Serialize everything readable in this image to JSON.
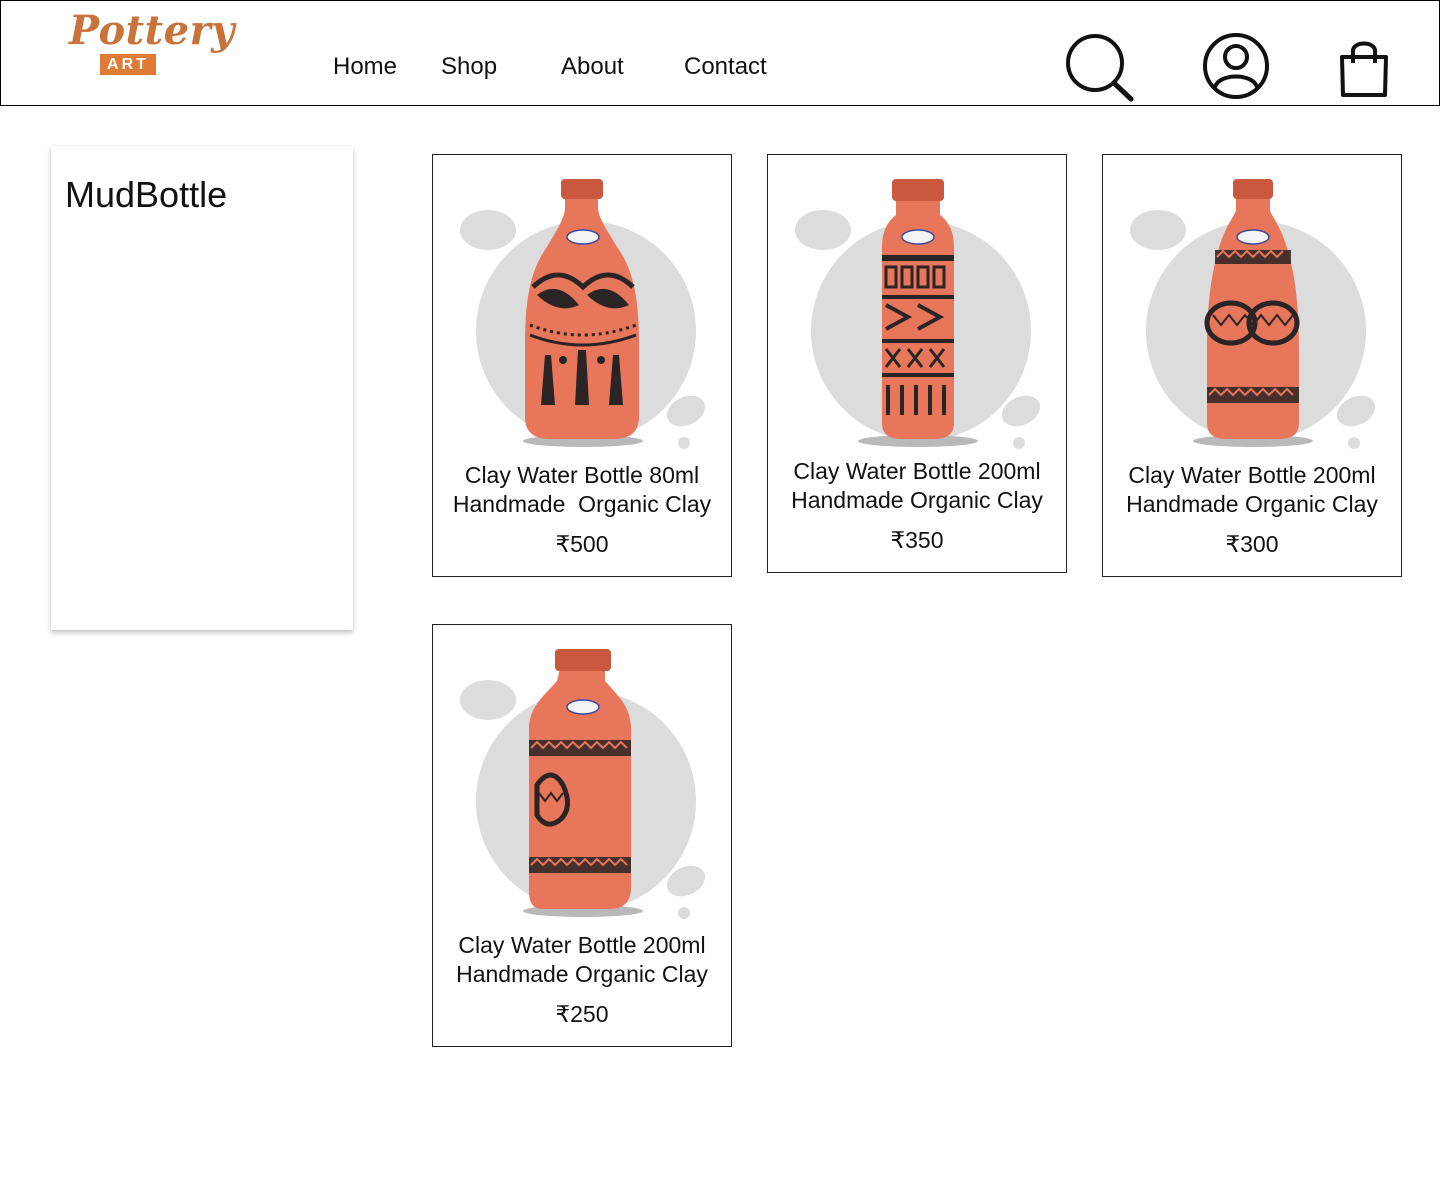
{
  "brand": {
    "script": "Pottery",
    "badge": "ART",
    "color": "#e07b35"
  },
  "nav": {
    "home": "Home",
    "shop": "Shop",
    "about": "About",
    "contact": "Contact"
  },
  "icons": {
    "search": "search-icon",
    "account": "account-icon",
    "cart": "shopping-bag-icon"
  },
  "sidebar": {
    "title": "MudBottle"
  },
  "products": [
    {
      "line1": "Clay Water Bottle 80ml",
      "line2": "Handmade  Organic Clay",
      "price": "₹500",
      "pattern": "fish"
    },
    {
      "line1": "Clay Water Bottle 200ml",
      "line2": "Handmade Organic Clay",
      "price": "₹350",
      "pattern": "geometric"
    },
    {
      "line1": "Clay Water Bottle 200ml",
      "line2": "Handmade Organic Clay",
      "price": "₹300",
      "pattern": "bands"
    },
    {
      "line1": "Clay Water Bottle 200ml",
      "line2": "Handmade Organic Clay",
      "price": "₹250",
      "pattern": "square"
    }
  ],
  "colors": {
    "terracotta": "#e8765a",
    "terracotta_dark": "#c9583f",
    "backdrop": "#dcdcdc"
  }
}
